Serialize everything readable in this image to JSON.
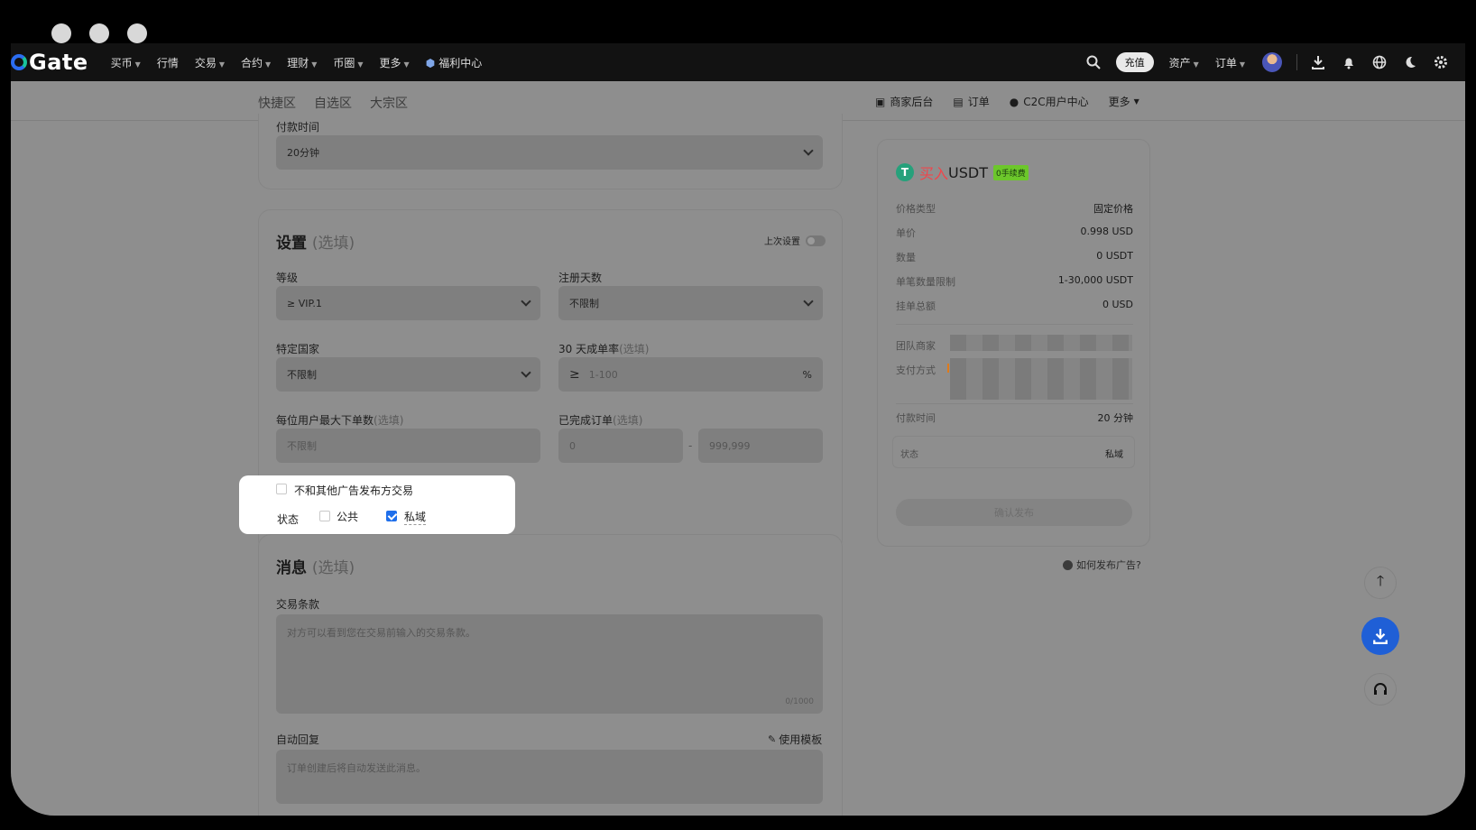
{
  "nav": {
    "logo": "Gate",
    "items": [
      "买币",
      "行情",
      "交易",
      "合约",
      "理财",
      "币圈",
      "更多"
    ],
    "welfare": "福利中心",
    "deposit": "充值",
    "assets": "资产",
    "orders": "订单"
  },
  "subnav": {
    "tabs": [
      "快捷区",
      "自选区",
      "大宗区"
    ],
    "merchant": "商家后台",
    "orders": "订单",
    "c2c": "C2C用户中心",
    "more": "更多"
  },
  "payment": {
    "label": "付款时间",
    "value": "20分钟"
  },
  "settings": {
    "title": "设置",
    "optional": "(选填)",
    "last_settings": "上次设置",
    "level_label": "等级",
    "level_value": "≥ VIP.1",
    "reg_days_label": "注册天数",
    "reg_days_value": "不限制",
    "country_label": "特定国家",
    "country_value": "不限制",
    "completion_label": "30 天成单率",
    "completion_opt": "(选填)",
    "completion_sign": "≥",
    "completion_placeholder": "1-100",
    "completion_unit": "%",
    "max_orders_label": "每位用户最大下单数",
    "max_orders_opt": "(选填)",
    "max_orders_placeholder": "不限制",
    "completed_label": "已完成订单",
    "completed_opt": "(选填)",
    "completed_min": "0",
    "completed_dash": "-",
    "completed_max": "999,999"
  },
  "options": {
    "no_trade_other": "不和其他广告发布方交易",
    "status_label": "状态",
    "public": "公共",
    "private": "私域",
    "public_checked": false,
    "private_checked": true
  },
  "message": {
    "title": "消息",
    "optional": "(选填)",
    "terms_label": "交易条款",
    "terms_placeholder": "对方可以看到您在交易前输入的交易条款。",
    "terms_count": "0/1000",
    "auto_reply_label": "自动回复",
    "use_template": "使用模板",
    "auto_reply_placeholder": "订单创建后将自动发送此消息。"
  },
  "summary": {
    "action": "买入",
    "asset": "USDT",
    "badge": "0手续费",
    "rows": [
      {
        "k": "价格类型",
        "v": "固定价格"
      },
      {
        "k": "单价",
        "v": "0.998 USD"
      },
      {
        "k": "数量",
        "v": "0 USDT"
      },
      {
        "k": "单笔数量限制",
        "v": "1-30,000 USDT"
      },
      {
        "k": "挂单总额",
        "v": "0 USD"
      }
    ],
    "team_merchant": "团队商家",
    "payment_method": "支付方式",
    "pay_time_label": "付款时间",
    "pay_time_value": "20 分钟",
    "status_label": "状态",
    "status_value": "私域",
    "confirm": "确认发布",
    "how_to": "如何发布广告?"
  },
  "colors": {
    "accent": "#1f6feb",
    "buy": "#f0454b",
    "tether": "#26a17b",
    "badge": "#6cc72b"
  }
}
